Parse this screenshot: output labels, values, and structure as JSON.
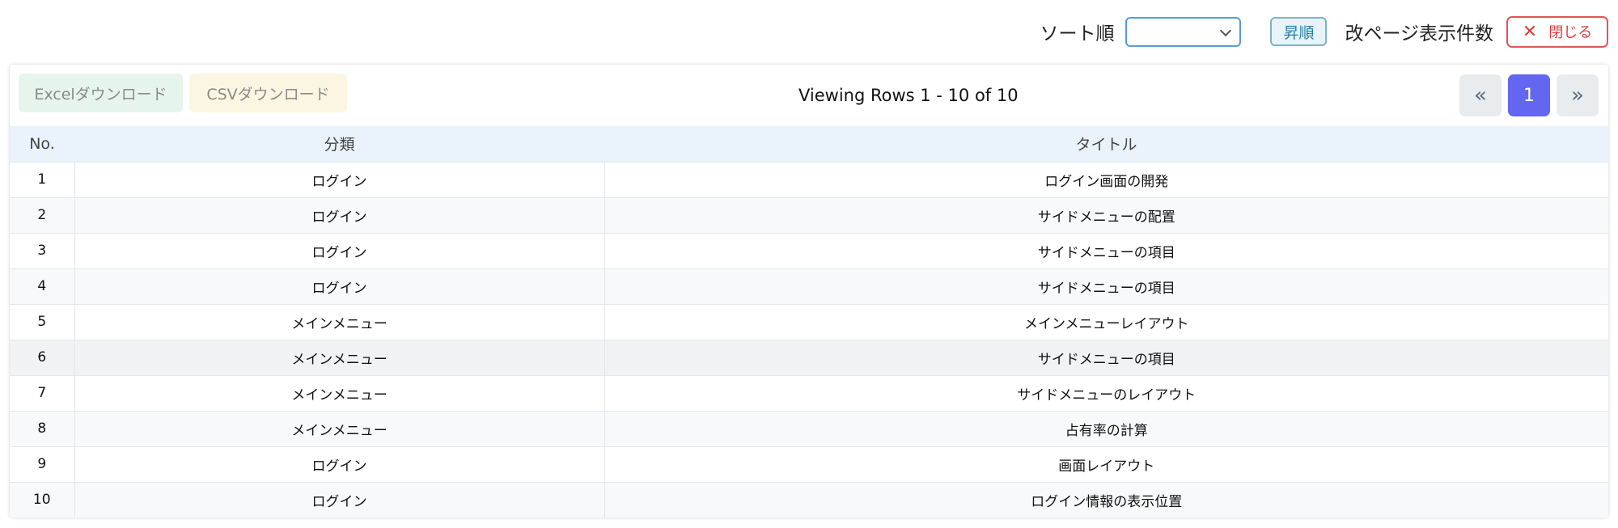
{
  "toolbar": {
    "sort_label": "ソート順",
    "sort_value": "",
    "asc_label": "昇順",
    "page_size_label": "改ページ表示件数",
    "close_label": "閉じる"
  },
  "panel": {
    "excel_download": "Excelダウンロード",
    "csv_download": "CSVダウンロード",
    "viewing": "Viewing Rows 1 - 10 of 10",
    "pager": {
      "first": "«",
      "current": "1",
      "last": "»"
    }
  },
  "table": {
    "headers": [
      "No.",
      "分類",
      "タイトル"
    ],
    "rows": [
      [
        "1",
        "ログイン",
        "ログイン画面の開発"
      ],
      [
        "2",
        "ログイン",
        "サイドメニューの配置"
      ],
      [
        "3",
        "ログイン",
        "サイドメニューの項目"
      ],
      [
        "4",
        "ログイン",
        "サイドメニューの項目"
      ],
      [
        "5",
        "メインメニュー",
        "メインメニューレイアウト"
      ],
      [
        "6",
        "メインメニュー",
        "サイドメニューの項目"
      ],
      [
        "7",
        "メインメニュー",
        "サイドメニューのレイアウト"
      ],
      [
        "8",
        "メインメニュー",
        "占有率の計算"
      ],
      [
        "9",
        "ログイン",
        "画面レイアウト"
      ],
      [
        "10",
        "ログイン",
        "ログイン情報の表示位置"
      ]
    ]
  },
  "colors": {
    "accent": "#6366f1",
    "close": "#d94040",
    "header_bg": "#eaf3fc"
  }
}
